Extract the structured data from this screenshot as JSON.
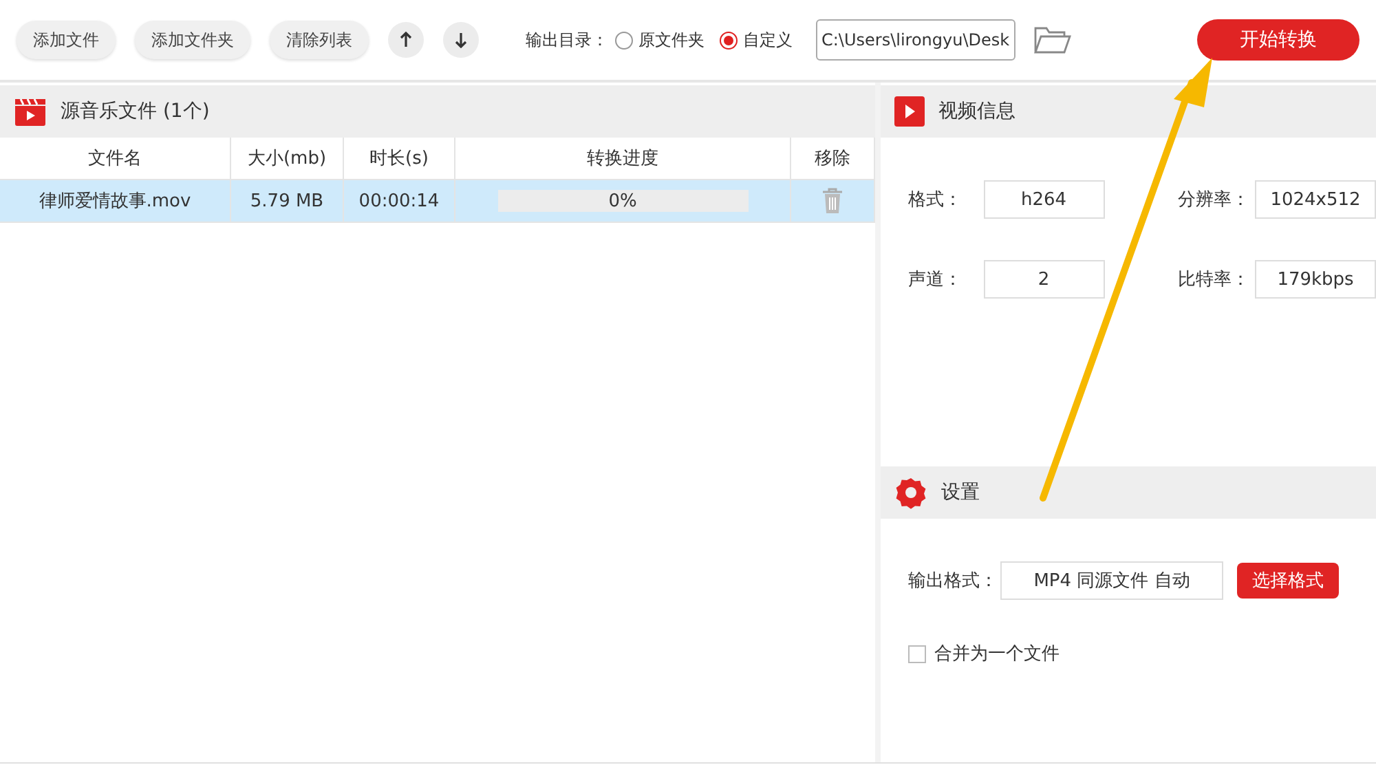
{
  "toolbar": {
    "buttons": [
      "添加文件",
      "添加文件夹",
      "清除列表"
    ],
    "output_dir": {
      "label": "输出目录：",
      "options": [
        {
          "label": "原文件夹",
          "selected": false
        },
        {
          "label": "自定义",
          "selected": true
        }
      ],
      "path": "C:\\Users\\lirongyu\\Desk"
    },
    "start_button": "开始转换"
  },
  "file_panel": {
    "title": "源音乐文件 (1个)",
    "columns": [
      "文件名",
      "大小(mb)",
      "时长(s)",
      "转换进度",
      "移除"
    ],
    "rows": [
      {
        "name": "律师爱情故事.mov",
        "size": "5.79 MB",
        "duration": "00:00:14",
        "progress": "0%",
        "selected": true
      }
    ]
  },
  "video_info": {
    "title": "视频信息",
    "fields": [
      {
        "label": "格式：",
        "value": "h264"
      },
      {
        "label": "分辨率：",
        "value": "1024x512"
      },
      {
        "label": "声道：",
        "value": "2"
      },
      {
        "label": "比特率：",
        "value": "179kbps"
      }
    ]
  },
  "settings": {
    "title": "设置",
    "output_format": {
      "label": "输出格式：",
      "value": "MP4 同源文件 自动"
    },
    "choose_button": "选择格式",
    "merge": {
      "label": "合并为一个文件",
      "checked": false
    }
  }
}
